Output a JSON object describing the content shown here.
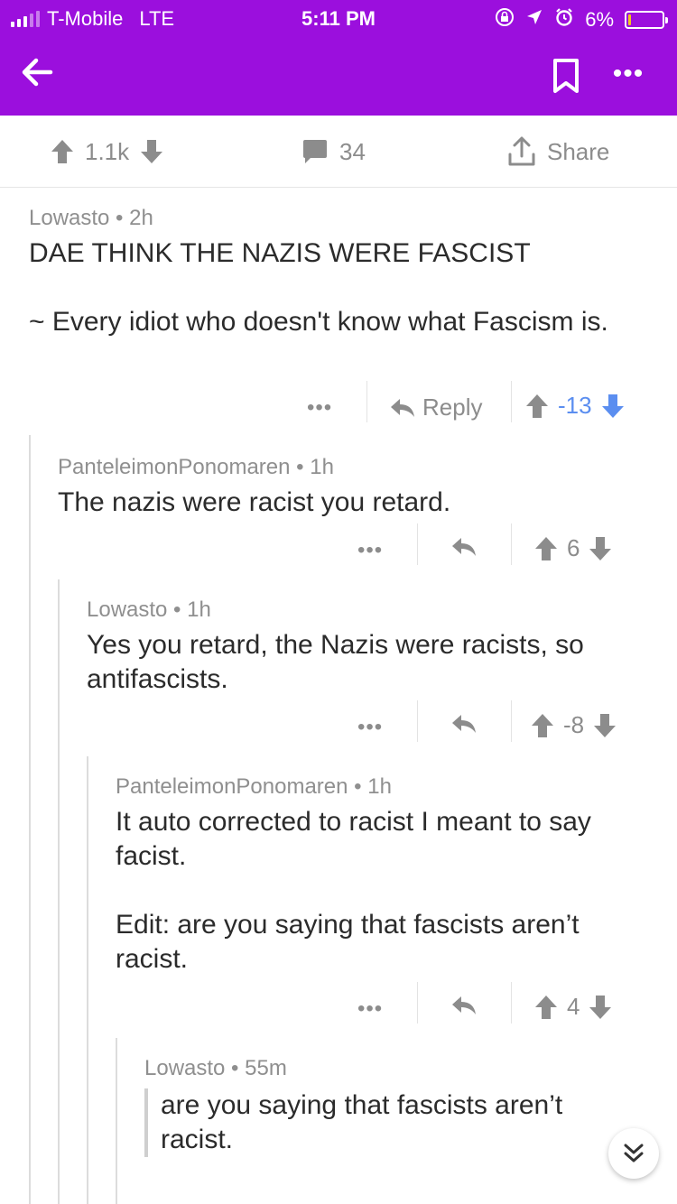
{
  "status_bar": {
    "carrier": "T-Mobile",
    "network": "LTE",
    "time": "5:11 PM",
    "battery_text": "6%",
    "battery_level": 0.06
  },
  "app_bar": {
    "icons": [
      "back-arrow-icon",
      "bookmark-icon",
      "more-icon"
    ],
    "color": "#9b0fdd"
  },
  "post_actions": {
    "upvotes": "1.1k",
    "comments": "34",
    "share_label": "Share"
  },
  "comments": [
    {
      "author": "Lowasto",
      "age": "2h",
      "body": "DAE THINK THE NAZIS WERE FASCIST\n\n~ Every idiot who doesn't know what Fascism is.",
      "reply_label": "Reply",
      "score": "-13"
    },
    {
      "author": "PanteleimonPonomaren",
      "age": "1h",
      "body": "The nazis were racist you retard.",
      "score": "6"
    },
    {
      "author": "Lowasto",
      "age": "1h",
      "body": "Yes you retard, the Nazis were racists, so antifascists.",
      "score": "-8"
    },
    {
      "author": "PanteleimonPonomaren",
      "age": "1h",
      "body": "It auto corrected to racist I meant to say facist.\n\nEdit: are you saying that fascists aren’t racist.",
      "score": "4"
    },
    {
      "author": "Lowasto",
      "age": "55m",
      "quote": "are you saying that fascists aren’t racist."
    }
  ],
  "colors": {
    "accent_purple": "#9b0fdd",
    "downvote_blue": "#5b8ef0",
    "muted": "#8c8c8c"
  }
}
